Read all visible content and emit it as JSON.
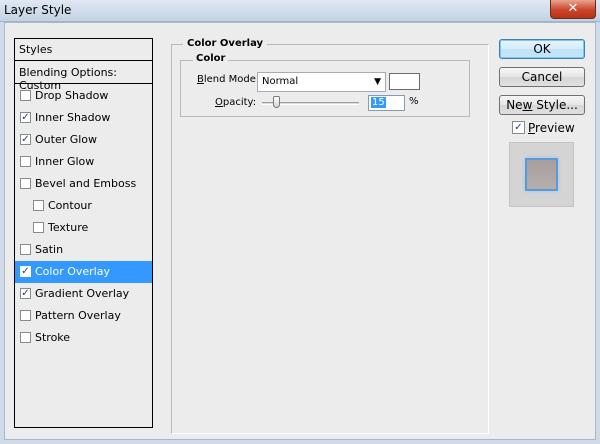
{
  "window": {
    "title": "Layer Style",
    "close_glyph": "✕"
  },
  "styles_list": {
    "header": "Styles",
    "blending_options": "Blending Options: Custom",
    "items": [
      {
        "label": "Drop Shadow",
        "checked": false,
        "indent": false,
        "selected": false
      },
      {
        "label": "Inner Shadow",
        "checked": true,
        "indent": false,
        "selected": false
      },
      {
        "label": "Outer Glow",
        "checked": true,
        "indent": false,
        "selected": false
      },
      {
        "label": "Inner Glow",
        "checked": false,
        "indent": false,
        "selected": false
      },
      {
        "label": "Bevel and Emboss",
        "checked": false,
        "indent": false,
        "selected": false
      },
      {
        "label": "Contour",
        "checked": false,
        "indent": true,
        "selected": false
      },
      {
        "label": "Texture",
        "checked": false,
        "indent": true,
        "selected": false
      },
      {
        "label": "Satin",
        "checked": false,
        "indent": false,
        "selected": false
      },
      {
        "label": "Color Overlay",
        "checked": true,
        "indent": false,
        "selected": true
      },
      {
        "label": "Gradient Overlay",
        "checked": true,
        "indent": false,
        "selected": false
      },
      {
        "label": "Pattern Overlay",
        "checked": false,
        "indent": false,
        "selected": false
      },
      {
        "label": "Stroke",
        "checked": false,
        "indent": false,
        "selected": false
      }
    ]
  },
  "panel": {
    "title": "Color Overlay",
    "group_title": "Color",
    "blend_mode_label_prefix": "B",
    "blend_mode_label_rest": "lend Mode:",
    "blend_mode_value": "Normal",
    "overlay_color": "#ffffff",
    "opacity_label_prefix": "O",
    "opacity_label_rest": "pacity:",
    "opacity_value": "15",
    "opacity_unit": "%",
    "opacity_fraction": 0.15
  },
  "buttons": {
    "ok": "OK",
    "cancel": "Cancel",
    "new_style_prefix": "Ne",
    "new_style_underline": "w",
    "new_style_rest": " Style...",
    "preview_label_prefix": "P",
    "preview_label_rest": "review",
    "preview_checked": true
  },
  "check_glyph": "✓",
  "icons": {
    "dropdown": "chevron-down-icon",
    "close": "close-icon",
    "check": "check-icon"
  }
}
